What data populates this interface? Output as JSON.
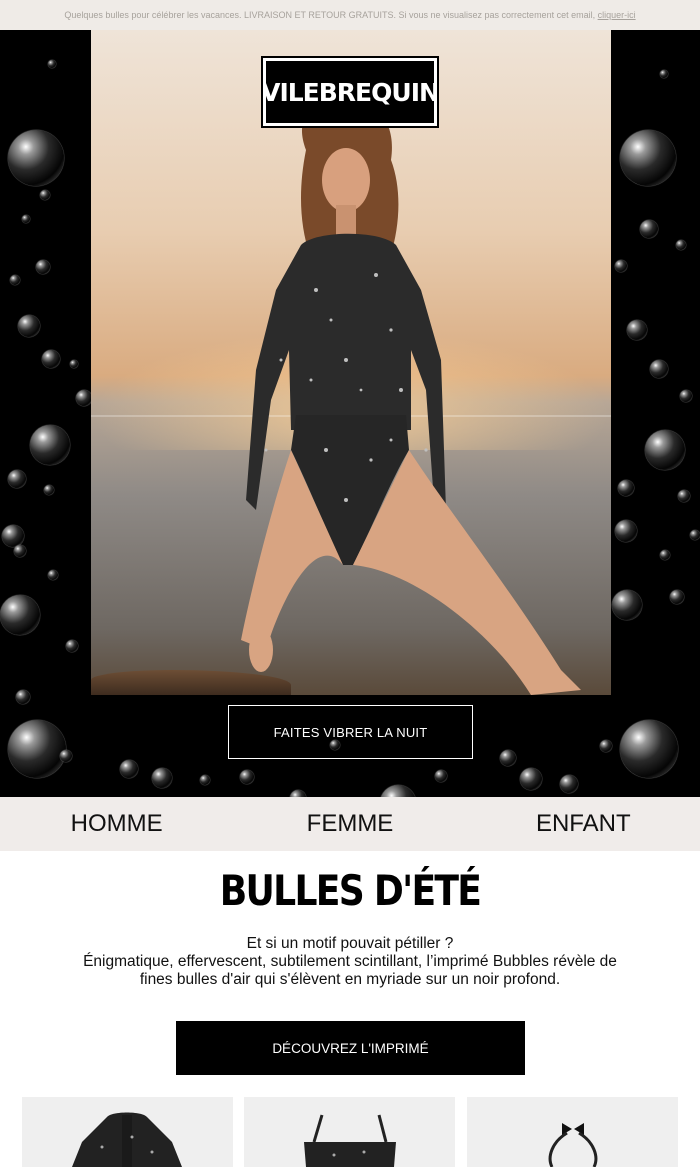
{
  "preheader": {
    "text": "Quelques bulles pour célébrer les vacances. LIVRAISON ET RETOUR GRATUITS. Si vous ne visualisez pas correctement cet email,",
    "link": "cliquer-ici"
  },
  "brand": {
    "logo_text": "VILEBREQUIN"
  },
  "hero": {
    "cta_label": "FAITES VIBRER LA NUIT"
  },
  "nav": {
    "items": [
      "HOMME",
      "FEMME",
      "ENFANT"
    ]
  },
  "content": {
    "headline": "BULLES D'ÉTÉ",
    "line1": "Et si un motif pouvait pétiller ?",
    "line2": "Énigmatique, effervescent, subtilement scintillant, l’imprimé Bubbles révèle de",
    "line3": "fines bulles d'air qui s'élèvent en myriade sur un noir profond.",
    "cta_label": "DÉCOUVREZ L'IMPRIMÉ"
  },
  "colors": {
    "hero_bg": "#000000",
    "nav_bg": "#f0ecea",
    "preheader_bg": "#efebe7",
    "cta_bg": "#000000"
  }
}
